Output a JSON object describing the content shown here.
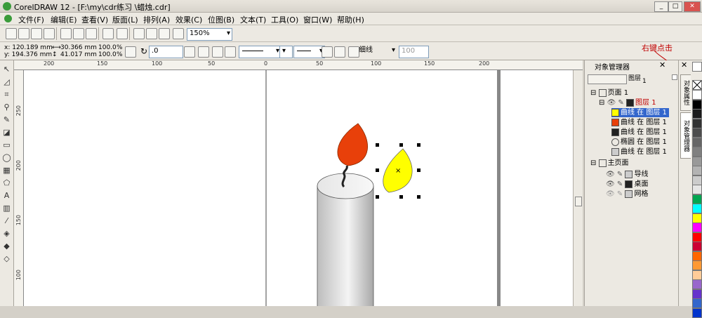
{
  "window": {
    "title": "CorelDRAW 12 - [F:\\my\\cdr练习  \\蜡烛.cdr]"
  },
  "menu": [
    "文件(F)",
    "编辑(E)",
    "查看(V)",
    "版面(L)",
    "排列(A)",
    "效果(C)",
    "位图(B)",
    "文本(T)",
    "工具(O)",
    "窗口(W)",
    "帮助(H)"
  ],
  "toolbar": {
    "zoom": "150%"
  },
  "propbar": {
    "x": "x: 120.189 mm",
    "y": "y: 194.376 mm",
    "w": "30.366 mm",
    "h": "41.017 mm",
    "sx": "100.0",
    "sy": "100.0",
    "pct": "%",
    "rotate": ".0",
    "outline": "细线",
    "size": "100"
  },
  "ruler": {
    "h": [
      "200",
      "150",
      "100",
      "50",
      "0",
      "50",
      "100",
      "150",
      "200"
    ],
    "v": [
      "250",
      "200",
      "150",
      "100"
    ]
  },
  "annotation": "右键点击",
  "docker": {
    "title": "对象管理器",
    "layer_label": "图层",
    "layer_value": "1",
    "page1": "页面 1",
    "layer1": "图层 1",
    "objects": [
      "曲线 在 图层 1",
      "曲线 在 图层 1",
      "曲线 在 图层 1",
      "椭圆 在 图层 1",
      "曲线 在 图层 1"
    ],
    "master": "主页面",
    "master_layers": [
      "导线",
      "桌面",
      "网格"
    ]
  },
  "sidetabs": [
    "对象属性",
    "对象管理器"
  ],
  "colors": {
    "flame": "#e8400a",
    "leaf": "#ffff00",
    "selection": "#3366cc",
    "palette": [
      "#ffffff",
      "#000000",
      "#1a1a1a",
      "#333333",
      "#4d4d4d",
      "#666666",
      "#808080",
      "#999999",
      "#b3b3b3",
      "#cccccc",
      "#e6e6e6",
      "#00a651",
      "#00ffff",
      "#ffff00",
      "#ff00ff",
      "#ff0000",
      "#cc0033",
      "#ff6600",
      "#ff9933",
      "#ffcc99",
      "#9966cc",
      "#6633cc",
      "#3366cc",
      "#0033cc"
    ]
  }
}
